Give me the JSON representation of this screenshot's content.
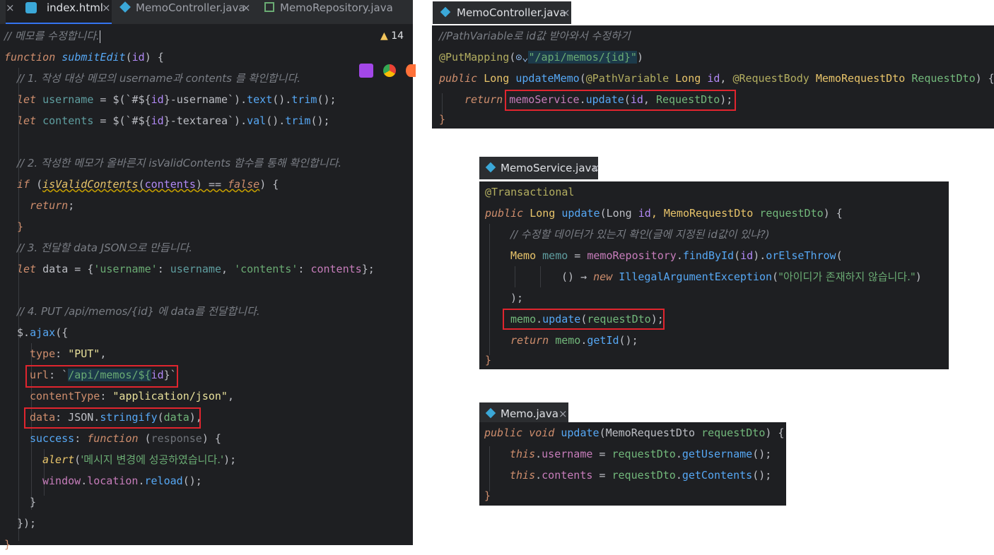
{
  "left_editor": {
    "tabs": [
      {
        "label": "index.html",
        "active": true,
        "close": "×"
      },
      {
        "label": "MemoController.java",
        "active": false,
        "close": "×"
      },
      {
        "label": "MemoRepository.java",
        "active": false,
        "close": ""
      }
    ],
    "warning_count": "14",
    "lines": {
      "l1": "// 메모를 수정합니다.",
      "l2a": "function",
      "l2b": "submitEdit",
      "l2c": "(",
      "l2d": "id",
      "l2e": ") {",
      "l3": "// 1. 작성 대상 메모의 username과 contents 를 확인합니다.",
      "l4a": "let",
      "l4b": "username",
      "l4c": " = $(`#${",
      "l4d": "id",
      "l4e": "}-username`).",
      "l4f": "text",
      "l4g": "().",
      "l4h": "trim",
      "l4i": "();",
      "l5a": "let",
      "l5b": "contents",
      "l5c": " = $(`#${",
      "l5d": "id",
      "l5e": "}-textarea`).",
      "l5f": "val",
      "l5g": "().",
      "l5h": "trim",
      "l5i": "();",
      "l7": "// 2. 작성한 메모가 올바른지 isValidContents 함수를 통해 확인합니다.",
      "l8a": "if",
      "l8b": " (",
      "l8c": "isValidContents",
      "l8d": "(",
      "l8e": "contents",
      "l8f": ") ",
      "l8g": "==",
      "l8h": " ",
      "l8i": "false",
      "l8j": ") {",
      "l9": "return",
      "l9b": ";",
      "l10": "}",
      "l11": "// 3. 전달할 data JSON으로 만듭니다.",
      "l12a": "let",
      "l12b": " data = {",
      "l12c": "'username'",
      "l12d": ": ",
      "l12e": "username",
      "l12f": ", ",
      "l12g": "'contents'",
      "l12h": ": ",
      "l12i": "contents",
      "l12j": "};",
      "l14": "// 4. PUT /api/memos/{id} 에 data를 전달합니다.",
      "l15a": "$.",
      "l15b": "ajax",
      "l15c": "({",
      "l16a": "type",
      "l16b": ": ",
      "l16c": "\"PUT\"",
      "l16d": ",",
      "l17a": "url",
      "l17b": ": `",
      "l17c": "/api/memos/${",
      "l17d": "id",
      "l17e": "}`",
      "l18a": "contentType",
      "l18b": ": ",
      "l18c": "\"application/json\"",
      "l18d": ",",
      "l19a": "data",
      "l19b": ": JSON.",
      "l19c": "stringify",
      "l19d": "(",
      "l19e": "data",
      "l19f": "),",
      "l20a": "success",
      "l20b": ": ",
      "l20c": "function",
      "l20d": " (",
      "l20e": "response",
      "l20f": ") {",
      "l21a": "alert",
      "l21b": "(",
      "l21c": "'메시지 변경에 성공하였습니다.'",
      "l21d": ");",
      "l22a": "window",
      "l22b": ".",
      "l22c": "location",
      "l22d": ".",
      "l22e": "reload",
      "l22f": "();",
      "l23": "}",
      "l24": "});",
      "l25": "}"
    }
  },
  "controller": {
    "tab": "MemoController.java",
    "close": "×",
    "c1": "//PathVariable로 id값 받아와서 수정하기",
    "c2a": "@PutMapping",
    "c2b": "(",
    "c2c": "\"/api/memos/{id}\"",
    "c2d": ")",
    "c3a": "public",
    "c3b": " Long ",
    "c3c": "updateMemo",
    "c3d": "(",
    "c3e": "@PathVariable",
    "c3f": " Long ",
    "c3g": "id",
    "c3h": ", ",
    "c3i": "@RequestBody",
    "c3j": " MemoRequestDto ",
    "c3k": "RequestDto",
    "c3l": ") {",
    "c4a": "return",
    "c4b": "memoService",
    "c4c": ".",
    "c4d": "update",
    "c4e": "(",
    "c4f": "id",
    "c4g": ", ",
    "c4h": "RequestDto",
    "c4i": ");",
    "c5": "}"
  },
  "service": {
    "tab": "MemoService.java",
    "close": "×",
    "s1": "@Transactional",
    "s2a": "public",
    "s2b": " Long ",
    "s2c": "update",
    "s2d": "(Long ",
    "s2e": "id",
    "s2f": ", MemoRequestDto ",
    "s2g": "requestDto",
    "s2h": ") {",
    "s3": "// 수정할 데이터가 있는지 확인(글에 지정된 id값이 있냐?)",
    "s4a": "Memo",
    "s4b": " memo",
    "s4c": " = ",
    "s4d": "memoRepository",
    "s4e": ".",
    "s4f": "findById",
    "s4g": "(",
    "s4h": "id",
    "s4i": ").",
    "s4j": "orElseThrow",
    "s4k": "(",
    "s5a": "() → ",
    "s5b": "new",
    "s5c": " IllegalArgumentException",
    "s5d": "(",
    "s5e": "\"아이디가 존재하지 않습니다.\"",
    "s5f": ")",
    "s6": ");",
    "s7a": "memo",
    "s7b": ".",
    "s7c": "update",
    "s7d": "(",
    "s7e": "requestDto",
    "s7f": ");",
    "s8a": "return",
    "s8b": " memo",
    "s8c": ".",
    "s8d": "getId",
    "s8e": "();",
    "s9": "}"
  },
  "memo": {
    "tab": "Memo.java",
    "close": "×",
    "m1a": "public",
    "m1b": " ",
    "m1c": "void",
    "m1d": " ",
    "m1e": "update",
    "m1f": "(MemoRequestDto ",
    "m1g": "requestDto",
    "m1h": ") {",
    "m2a": "this",
    "m2b": ".",
    "m2c": "username",
    "m2d": " = ",
    "m2e": "requestDto",
    "m2f": ".",
    "m2g": "getUsername",
    "m2h": "();",
    "m3a": "this",
    "m3b": ".",
    "m3c": "contents",
    "m3d": " = ",
    "m3e": "requestDto",
    "m3f": ".",
    "m3g": "getContents",
    "m3h": "();",
    "m4": "}"
  },
  "colors": {
    "editor_bg": "#1e1f22",
    "highlight_red": "#e0252e",
    "keyword": "#cf8e6d",
    "function": "#56a8f5",
    "string": "#6aab73"
  }
}
